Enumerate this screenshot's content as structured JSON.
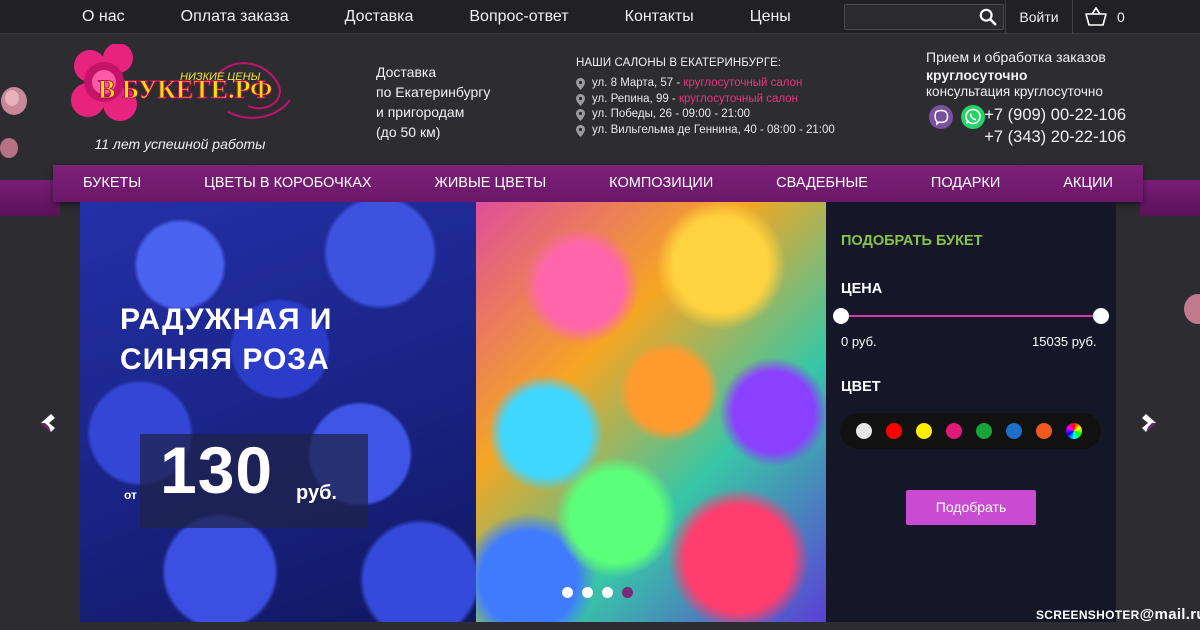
{
  "topbar": {
    "nav": [
      "О нас",
      "Оплата заказа",
      "Доставка",
      "Вопрос-ответ",
      "Контакты",
      "Цены"
    ],
    "search_placeholder": "",
    "login_label": "Войти",
    "cart_count": "0"
  },
  "logo": {
    "tagline_small": "НИЗКИЕ ЦЕНЫ",
    "name": "В БУКЕТЕ.РФ",
    "subtitle": "11 лет успешной работы"
  },
  "delivery": {
    "lines": [
      "Доставка",
      "по Екатеринбургу",
      "и пригородам",
      "(до 50 км)"
    ]
  },
  "salons": {
    "title": "НАШИ САЛОНЫ В ЕКАТЕРИНБУРГЕ:",
    "items": [
      {
        "address": "ул. 8 Марта, 57 - ",
        "hours": "круглосуточный салон",
        "highlight": true
      },
      {
        "address": "ул. Репина, 99 - ",
        "hours": "круглосуточный салон",
        "highlight": true
      },
      {
        "address": "ул. Победы, 26 - ",
        "hours": "09:00 - 21:00",
        "highlight": false
      },
      {
        "address": "ул. Вильгельма де Геннина, 40 - ",
        "hours": "08:00 - 21:00",
        "highlight": false
      }
    ]
  },
  "contact": {
    "line1": "Прием и обработка заказов",
    "line2": "круглосуточно",
    "line3": "консультация круглосуточно",
    "phone1": "+7 (909) 00-22-106",
    "phone2": "+7 (343) 20-22-106"
  },
  "mainnav": [
    "БУКЕТЫ",
    "ЦВЕТЫ В КОРОБОЧКАХ",
    "ЖИВЫЕ ЦВЕТЫ",
    "КОМПОЗИЦИИ",
    "СВАДЕБНЫЕ",
    "ПОДАРКИ",
    "АКЦИИ"
  ],
  "slide": {
    "title_line1": "РАДУЖНАЯ И",
    "title_line2": "СИНЯЯ РОЗА",
    "price_prefix": "от",
    "price": "130",
    "currency": "руб.",
    "dots_total": 4,
    "dots_active_index": 3
  },
  "filter": {
    "title": "ПОДОБРАТЬ БУКЕТ",
    "price_label": "ЦЕНА",
    "min_label": "0 руб.",
    "max_label": "15035 руб.",
    "color_label": "ЦВЕТ",
    "swatches": [
      "#e6e6e6",
      "#ff0000",
      "#ffee00",
      "#e0197a",
      "#1aa33a",
      "#1e6fc9",
      "#f05a1e",
      "rainbow"
    ],
    "button_label": "Подобрать"
  },
  "colors": {
    "accent_purple": "#7d2079",
    "accent_pink": "#e9347d",
    "accent_green": "#88c34a",
    "button": "#c94bd1"
  },
  "watermark": {
    "left": "SCREENSHOTER",
    "right": "@mail.ru"
  }
}
